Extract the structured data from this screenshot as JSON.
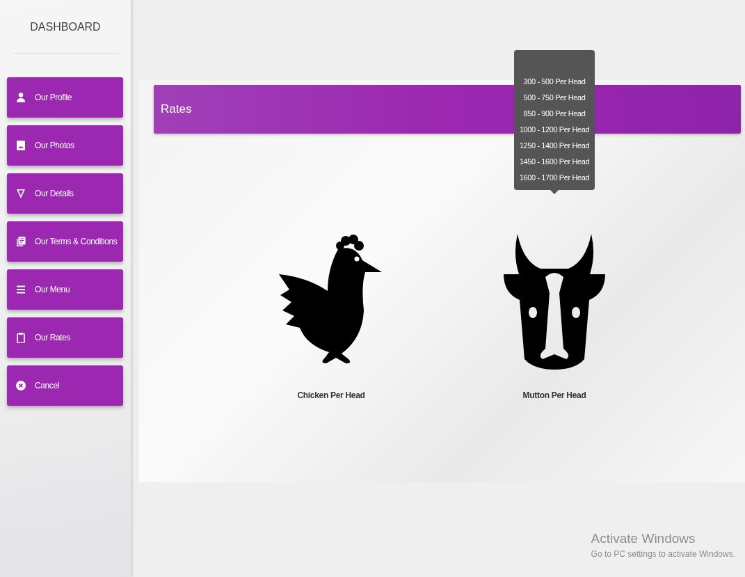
{
  "sidebar": {
    "title": "DASHBOARD",
    "items": [
      {
        "label": "Our Profile",
        "kind": "person"
      },
      {
        "label": "Our Photos",
        "kind": "image"
      },
      {
        "label": "Our Details",
        "kind": "triangle"
      },
      {
        "label": "Our Terms & Conditions",
        "kind": "document"
      },
      {
        "label": "Our Menu",
        "kind": "list"
      },
      {
        "label": "Our Rates",
        "kind": "clipboard"
      },
      {
        "label": "Cancel",
        "kind": "cancel"
      }
    ]
  },
  "rates": {
    "title": "Rates",
    "items": [
      {
        "kind": "chicken",
        "label": "Chicken Per Head"
      },
      {
        "kind": "cow",
        "label": "Mutton Per Head",
        "tooltip": [
          "300 - 500 Per Head",
          "500 - 750 Per Head",
          "850 - 900 Per Head",
          "1000 - 1200 Per Head",
          "1250 - 1400 Per Head",
          "1450 - 1600 Per Head",
          "1600 - 1700 Per Head"
        ]
      }
    ]
  },
  "os_notice": {
    "title": "Activate Windows",
    "text": "Go to PC settings to activate Windows."
  }
}
